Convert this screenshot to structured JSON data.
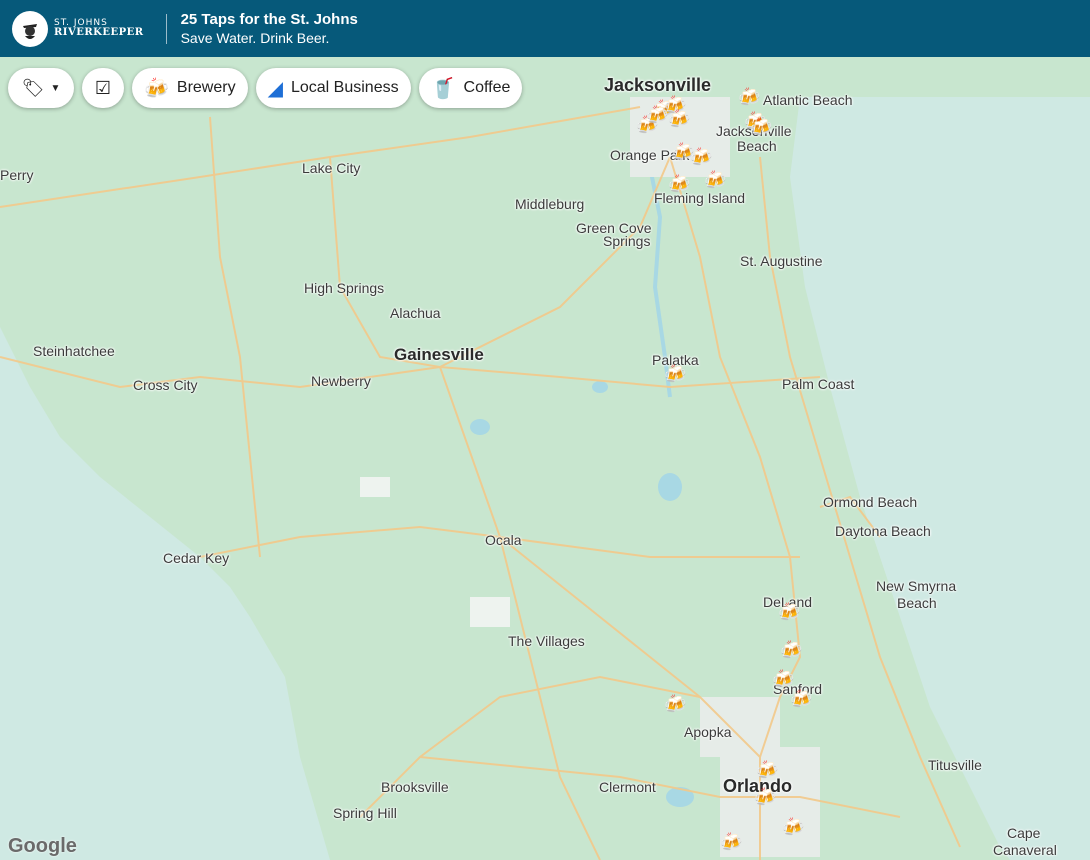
{
  "header": {
    "logo_small": "ST. JOHNS",
    "logo_big": "RIVERKEEPER",
    "title": "25 Taps for the St. Johns",
    "subtitle": "Save Water. Drink Beer."
  },
  "filters": {
    "tag_icon": "tag-icon",
    "check_icon": "check-bubble-icon",
    "brewery": "Brewery",
    "local_business": "Local Business",
    "coffee": "Coffee"
  },
  "places": [
    {
      "name": "Jacksonville",
      "cls": "major"
    },
    {
      "name": "Atlantic Beach",
      "cls": ""
    },
    {
      "name": "Jacksonville",
      "cls": ""
    },
    {
      "name": "Beach",
      "cls": ""
    },
    {
      "name": "Orange Park",
      "cls": ""
    },
    {
      "name": "Lake City",
      "cls": ""
    },
    {
      "name": "Perry",
      "cls": ""
    },
    {
      "name": "Middleburg",
      "cls": ""
    },
    {
      "name": "Fleming Island",
      "cls": ""
    },
    {
      "name": "Green Cove",
      "cls": ""
    },
    {
      "name": "Springs",
      "cls": ""
    },
    {
      "name": "St. Augustine",
      "cls": ""
    },
    {
      "name": "High Springs",
      "cls": ""
    },
    {
      "name": "Alachua",
      "cls": ""
    },
    {
      "name": "Gainesville",
      "cls": "mid"
    },
    {
      "name": "Steinhatchee",
      "cls": ""
    },
    {
      "name": "Cross City",
      "cls": ""
    },
    {
      "name": "Newberry",
      "cls": ""
    },
    {
      "name": "Palatka",
      "cls": ""
    },
    {
      "name": "Palm Coast",
      "cls": ""
    },
    {
      "name": "Ormond Beach",
      "cls": ""
    },
    {
      "name": "Daytona Beach",
      "cls": ""
    },
    {
      "name": "Ocala",
      "cls": ""
    },
    {
      "name": "Cedar Key",
      "cls": ""
    },
    {
      "name": "New Smyrna",
      "cls": ""
    },
    {
      "name": "Beach",
      "cls": ""
    },
    {
      "name": "DeLand",
      "cls": ""
    },
    {
      "name": "The Villages",
      "cls": ""
    },
    {
      "name": "Sanford",
      "cls": ""
    },
    {
      "name": "Apopka",
      "cls": ""
    },
    {
      "name": "Titusville",
      "cls": ""
    },
    {
      "name": "Brooksville",
      "cls": ""
    },
    {
      "name": "Clermont",
      "cls": ""
    },
    {
      "name": "Orlando",
      "cls": "major"
    },
    {
      "name": "Spring Hill",
      "cls": ""
    },
    {
      "name": "Cape",
      "cls": ""
    },
    {
      "name": "Canaveral",
      "cls": ""
    }
  ],
  "marker_icon": "beer-mug-icon",
  "attribution": "Google"
}
